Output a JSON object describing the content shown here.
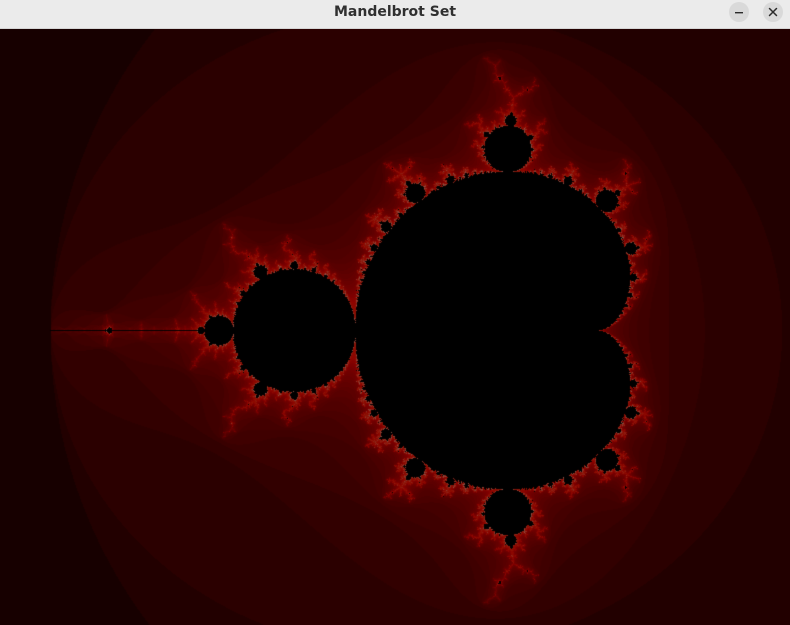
{
  "window": {
    "title": "Mandelbrot Set"
  },
  "controls": {
    "minimize_icon": "minimize-icon",
    "close_icon": "close-icon"
  },
  "render": {
    "palette": {
      "background": "#000000",
      "set_color": "#000000",
      "glow_color": "#ff2a00",
      "highlight_color": "#ffffff"
    },
    "max_iterations": 256
  }
}
